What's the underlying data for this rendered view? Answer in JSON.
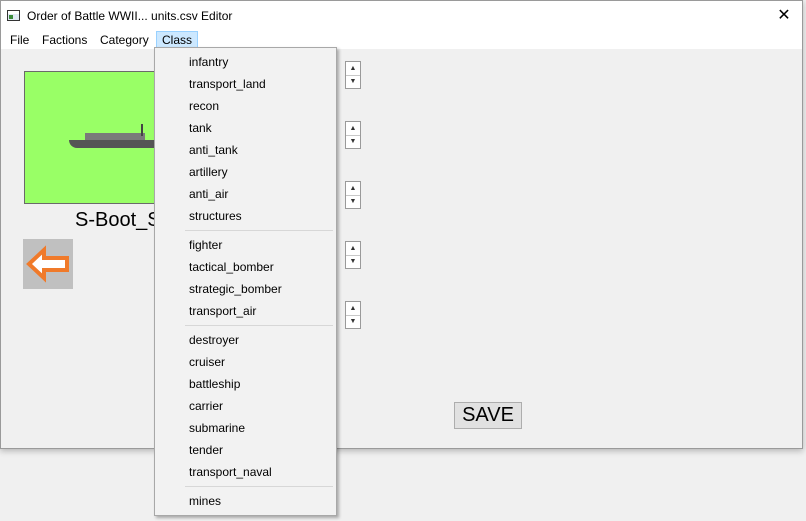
{
  "window": {
    "title": "Order of Battle WWII... units.csv Editor",
    "close_glyph": "✕"
  },
  "menubar": {
    "items": [
      "File",
      "Factions",
      "Category",
      "Class"
    ],
    "active": "Class"
  },
  "unit": {
    "name": "S-Boot_S"
  },
  "spinners": {
    "up_glyph": "▲",
    "down_glyph": "▼"
  },
  "save_label": "SAVE",
  "class_menu": {
    "groups": [
      [
        "infantry",
        "transport_land",
        "recon",
        "tank",
        "anti_tank",
        "artillery",
        "anti_air",
        "structures"
      ],
      [
        "fighter",
        "tactical_bomber",
        "strategic_bomber",
        "transport_air"
      ],
      [
        "destroyer",
        "cruiser",
        "battleship",
        "carrier",
        "submarine",
        "tender",
        "transport_naval"
      ],
      [
        "mines"
      ]
    ]
  },
  "colors": {
    "image_background": "#99ff66",
    "arrow": "#f07a2a",
    "menu_highlight": "#cce8ff"
  },
  "icons": {
    "back": "left-arrow-icon",
    "app": "window-app-icon"
  }
}
